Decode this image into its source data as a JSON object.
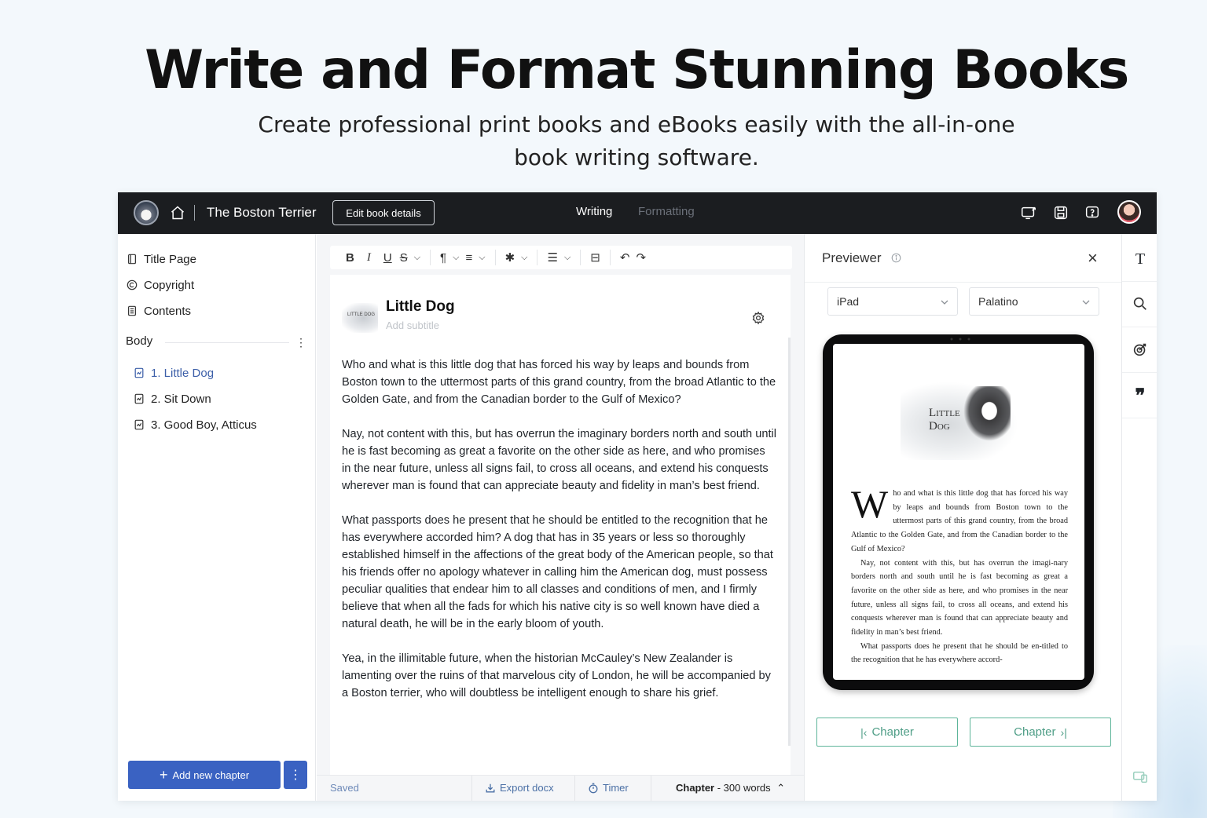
{
  "hero": {
    "title": "Write and Format Stunning Books",
    "subtitle": "Create professional print books and eBooks easily with the all-in-one book writing software."
  },
  "topbar": {
    "book_title": "The Boston Terrier",
    "edit_button": "Edit book details",
    "modes": [
      "Writing",
      "Formatting"
    ],
    "active_mode": "Writing"
  },
  "sidebar": {
    "front_matter": [
      {
        "label": "Title Page",
        "icon": "page-icon"
      },
      {
        "label": "Copyright",
        "icon": "copyright-icon"
      },
      {
        "label": "Contents",
        "icon": "list-icon"
      }
    ],
    "body_label": "Body",
    "chapters": [
      {
        "label": "1. Little Dog",
        "active": true
      },
      {
        "label": "2. Sit Down",
        "active": false
      },
      {
        "label": "3. Good Boy, Atticus",
        "active": false
      }
    ],
    "add_chapter": "Add new chapter"
  },
  "editor": {
    "chapter_title": "Little Dog",
    "subtitle_placeholder": "Add subtitle",
    "thumb_text": "LITTLE DOG",
    "paragraphs": [
      "Who and what is this little dog that has forced his way by leaps and bounds from Boston town to the uttermost parts of this grand country, from the broad Atlantic to the Golden Gate, and from the Canadian border to the Gulf of Mexico?",
      "Nay, not content with this, but has overrun the imaginary borders north and south until he is fast becoming as great a favorite on the other side as here, and who promises in the near future, unless all signs fail, to cross all oceans, and extend his conquests wherever man is found that can appreciate beauty and fidelity in man’s best friend.",
      "What passports does he present that he should be entitled to the recognition that he has everywhere accorded him? A dog that has in 35 years or less so thoroughly established himself in the affections of the great body of the American people, so that his friends offer no apology whatever in calling him the American dog, must possess peculiar qualities that endear him to all classes and conditions of men, and I firmly believe that when all the fads for which his native city is so well known have died a natural death, he will be in the early bloom of youth.",
      " Yea, in the illimitable future, when the historian McCauley’s New Zealander is lamenting over the ruins of that marvelous city of London, he will be accompanied by a Boston terrier, who will doubtless be intelligent enough to share his grief."
    ]
  },
  "statusbar": {
    "saved": "Saved",
    "export": "Export docx",
    "timer": "Timer",
    "chapter_label": "Chapter",
    "word_count": " - 300 words"
  },
  "previewer": {
    "title": "Previewer",
    "device": "iPad",
    "font": "Palatino",
    "illustration_text": "Little Dog",
    "dropcap": "W",
    "preview_first": "ho and what is this little dog that has forced his way by leaps and bounds from Boston town to the uttermost parts of this grand country, from the broad Atlantic to the Golden Gate, and from the Canadian border to the Gulf of Mexico?",
    "preview_second": "Nay, not content with this, but has overrun the imagi-nary borders north and south until he is fast becoming as great a favorite on the other side as here, and who promises in the near future, unless all signs fail, to cross all oceans, and extend his conquests wherever man is found that can appreciate beauty and fidelity in man’s best friend.",
    "preview_third": "What passports does he present that he should be en-titled to the recognition that he has everywhere accord-",
    "prev_chapter": "Chapter",
    "next_chapter": "Chapter"
  },
  "colors": {
    "accent": "#3a62c2",
    "topbar": "#1b1d20",
    "nav_green": "#4f9e87",
    "active_chapter": "#3b5ea8"
  }
}
